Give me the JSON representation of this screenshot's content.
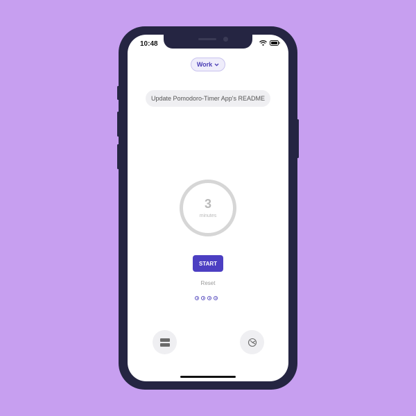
{
  "status_bar": {
    "time": "10:48"
  },
  "mode_selector": {
    "label": "Work"
  },
  "task": {
    "text": "Update Pomodoro-Timer App's README"
  },
  "timer": {
    "value": "3",
    "unit": "minutes"
  },
  "controls": {
    "start_label": "START",
    "reset_label": "Reset"
  },
  "sessions": {
    "count": 4
  },
  "colors": {
    "background": "#c79ff0",
    "accent": "#4c3fc2",
    "phone_frame": "#252542"
  },
  "icons": [
    "wifi-icon",
    "battery-icon",
    "chevron-down-icon",
    "session-clock-icon",
    "task-list-icon",
    "settings-icon"
  ]
}
